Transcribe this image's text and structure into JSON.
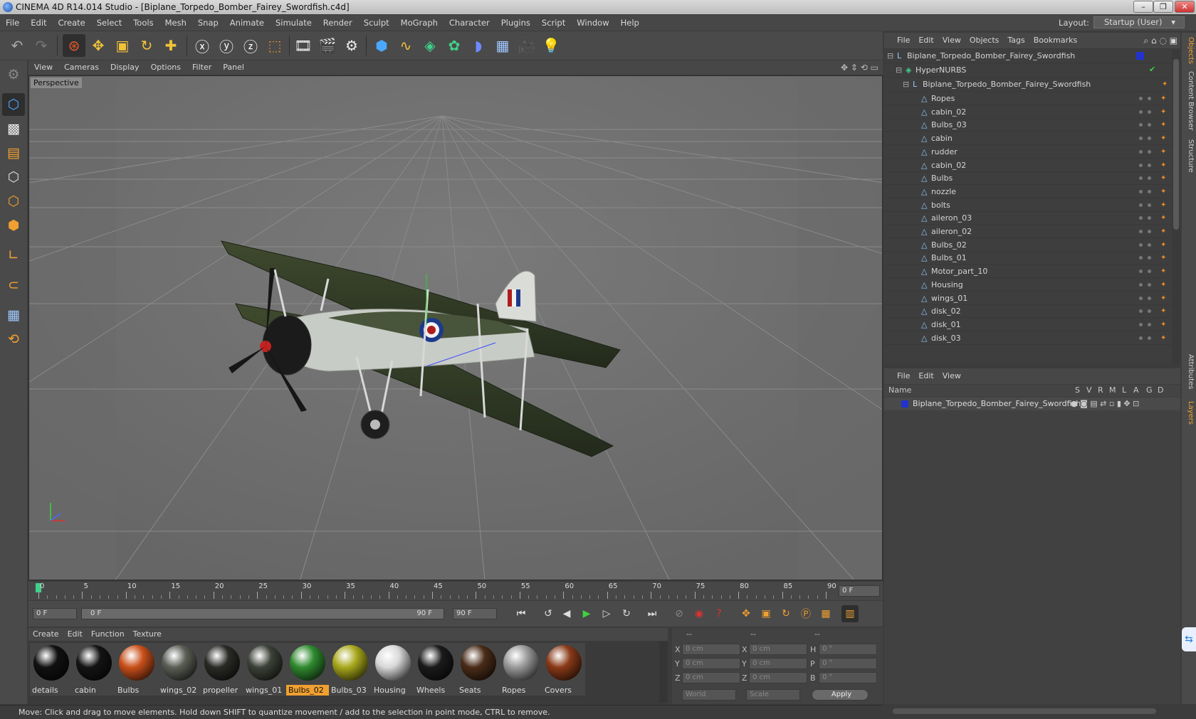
{
  "window": {
    "title": "CINEMA 4D R14.014 Studio - [Biplane_Torpedo_Bomber_Fairey_Swordfish.c4d]"
  },
  "menu": [
    "File",
    "Edit",
    "Create",
    "Select",
    "Tools",
    "Mesh",
    "Snap",
    "Animate",
    "Simulate",
    "Render",
    "Sculpt",
    "MoGraph",
    "Character",
    "Plugins",
    "Script",
    "Window",
    "Help"
  ],
  "layout": {
    "label": "Layout:",
    "value": "Startup (User)"
  },
  "viewport": {
    "menu": [
      "View",
      "Cameras",
      "Display",
      "Options",
      "Filter",
      "Panel"
    ],
    "label": "Perspective"
  },
  "timeline": {
    "ticks": [
      "0",
      "5",
      "10",
      "15",
      "20",
      "25",
      "30",
      "35",
      "40",
      "45",
      "50",
      "55",
      "60",
      "65",
      "70",
      "75",
      "80",
      "85",
      "90"
    ],
    "current_frame": "0 F"
  },
  "transport": {
    "start": "0 F",
    "range_start": "0 F",
    "range_end": "90 F",
    "end": "90 F"
  },
  "materials": {
    "menu": [
      "Create",
      "Edit",
      "Function",
      "Texture"
    ],
    "items": [
      {
        "name": "details",
        "color": "#111111"
      },
      {
        "name": "cabin",
        "color": "#141414"
      },
      {
        "name": "Bulbs",
        "color": "#c9501a"
      },
      {
        "name": "wings_02",
        "color": "#5a5f55"
      },
      {
        "name": "propeller",
        "color": "#2a2a26"
      },
      {
        "name": "wings_01",
        "color": "#3c4238"
      },
      {
        "name": "Bulbs_02",
        "color": "#2f8a2f"
      },
      {
        "name": "Bulbs_03",
        "color": "#a8a81c"
      },
      {
        "name": "Housing",
        "color": "#d8d8d8"
      },
      {
        "name": "Wheels",
        "color": "#1b1b1b"
      },
      {
        "name": "Seats",
        "color": "#4a2c18"
      },
      {
        "name": "Ropes",
        "color": "#9a9a9a"
      },
      {
        "name": "Covers",
        "color": "#8a3a18"
      }
    ],
    "selected": "Bulbs_02"
  },
  "coordinates": {
    "headers": [
      "--",
      "--",
      "--"
    ],
    "rows": [
      {
        "a": "X",
        "av": "0 cm",
        "b": "X",
        "bv": "0 cm",
        "c": "H",
        "cv": "0 °"
      },
      {
        "a": "Y",
        "av": "0 cm",
        "b": "Y",
        "bv": "0 cm",
        "c": "P",
        "cv": "0 °"
      },
      {
        "a": "Z",
        "av": "0 cm",
        "b": "Z",
        "bv": "0 cm",
        "c": "B",
        "cv": "0 °"
      }
    ],
    "mode1": "World",
    "mode2": "Scale",
    "apply": "Apply"
  },
  "status": "Move: Click and drag to move elements. Hold down SHIFT to quantize movement / add to the selection in point mode, CTRL to remove.",
  "objects": {
    "menu": [
      "File",
      "Edit",
      "View",
      "Objects",
      "Tags",
      "Bookmarks"
    ],
    "root": "Biplane_Torpedo_Bomber_Fairey_Swordfish",
    "nurbs": "HyperNURBS",
    "child": "Biplane_Torpedo_Bomber_Fairey_Swordfish",
    "items": [
      {
        "name": "Ropes",
        "tag": "#1a1a1a"
      },
      {
        "name": "cabin_02",
        "tag": "#111"
      },
      {
        "name": "Bulbs_03",
        "tag": "#c9501a"
      },
      {
        "name": "cabin",
        "tag": "#111"
      },
      {
        "name": "rudder",
        "tag": "#444"
      },
      {
        "name": "cabin_02",
        "tag": "#111"
      },
      {
        "name": "Bulbs",
        "tag": "#c9501a"
      },
      {
        "name": "nozzle",
        "tag": "#111"
      },
      {
        "name": "bolts",
        "tag": "#111"
      },
      {
        "name": "aileron_03",
        "tag": "#3c4238"
      },
      {
        "name": "aileron_02",
        "tag": "#5a5f55"
      },
      {
        "name": "Bulbs_02",
        "tag": "#2f8a2f"
      },
      {
        "name": "Bulbs_01",
        "tag": "#a8a81c"
      },
      {
        "name": "Motor_part_10",
        "tag": "#111"
      },
      {
        "name": "Housing",
        "tag": "#bbb"
      },
      {
        "name": "wings_01",
        "tag": "#3c4238"
      },
      {
        "name": "disk_02",
        "tag": "#999"
      },
      {
        "name": "disk_01",
        "tag": "#999"
      },
      {
        "name": "disk_03",
        "tag": "#999"
      }
    ]
  },
  "layers": {
    "menu": [
      "File",
      "Edit",
      "View"
    ],
    "headers": [
      "Name",
      "S",
      "V",
      "R",
      "M",
      "L",
      "A",
      "G",
      "D"
    ],
    "item": "Biplane_Torpedo_Bomber_Fairey_Swordfish"
  },
  "sidetabs": [
    "Objects",
    "Content Browser",
    "Structure",
    "Attributes",
    "Layers"
  ]
}
